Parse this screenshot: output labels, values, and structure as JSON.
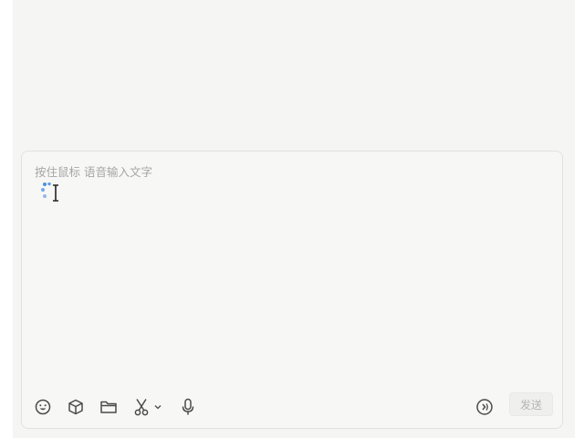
{
  "composer": {
    "placeholder": "按住鼠标 语音输入文字",
    "send_label": "发送"
  },
  "toolbar": {
    "icons": [
      "emoji-icon",
      "cube-icon",
      "folder-icon",
      "scissors-icon",
      "chevron-down-icon",
      "microphone-icon",
      "audio-icon"
    ]
  },
  "colors": {
    "background": "#f5f5f3",
    "composer_border": "#e1e1de",
    "placeholder": "#a6a6a6",
    "icon": "#4a4a4a",
    "recording_dots": "#4a8fe0"
  }
}
